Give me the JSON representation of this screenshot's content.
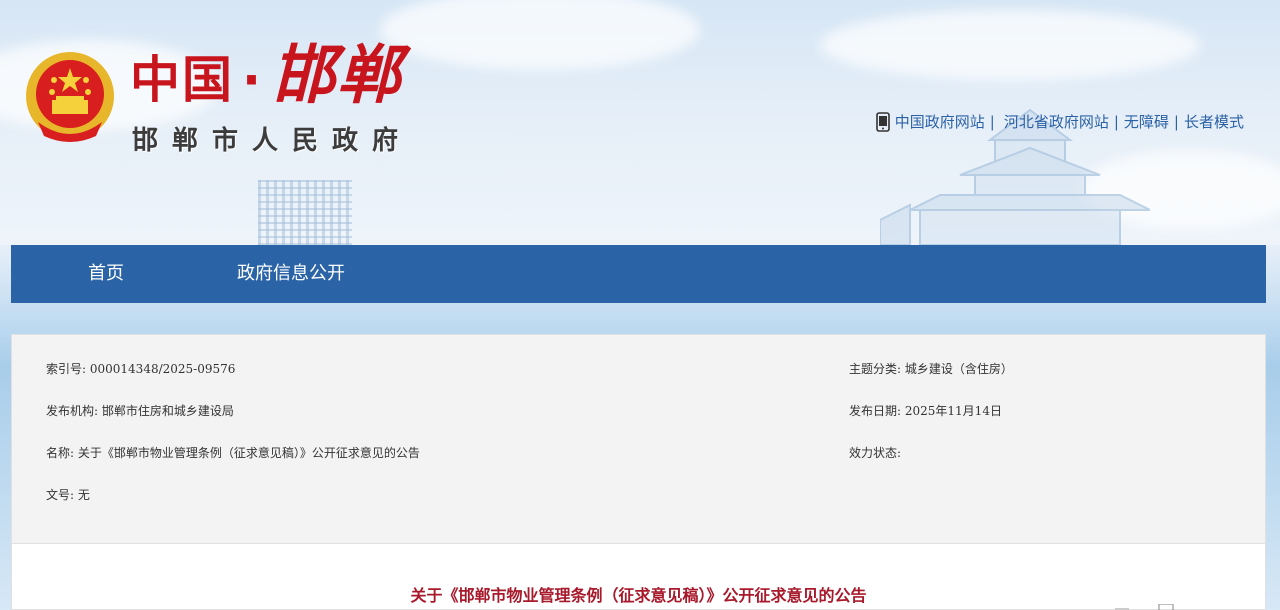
{
  "header": {
    "logo_main_left": "中国",
    "logo_dot": "·",
    "logo_main_right": "邯郸",
    "logo_sub": "邯郸市人民政府",
    "links": {
      "gov_cn": "中国政府网站",
      "hebei": "河北省政府网站",
      "accessibility": "无障碍",
      "elder_mode": "长者模式",
      "separator": "|"
    }
  },
  "nav": {
    "home": "首页",
    "gov_info": "政府信息公开"
  },
  "info": {
    "index_label": "索引号:",
    "index_value": "000014348/2025-09576",
    "topic_label": "主题分类:",
    "topic_value": "城乡建设（含住房）",
    "publisher_label": "发布机构:",
    "publisher_value": "邯郸市住房和城乡建设局",
    "date_label": "发布日期:",
    "date_value": "2025年11月14日",
    "name_label": "名称:",
    "name_value": "关于《邯郸市物业管理条例（征求意见稿）》公开征求意见的公告",
    "status_label": "效力状态:",
    "status_value": "",
    "docno_label": "文号:",
    "docno_value": "无"
  },
  "content": {
    "title": "关于《邯郸市物业管理条例（征求意见稿）》公开征求意见的公告"
  },
  "colors": {
    "nav_bg": "#2a64a6",
    "logo_red": "#c8151d",
    "link_blue": "#2b62a6",
    "title_red": "#a8192b"
  },
  "icons": {
    "emblem": "national-emblem-icon",
    "phone": "mobile-phone-icon"
  }
}
